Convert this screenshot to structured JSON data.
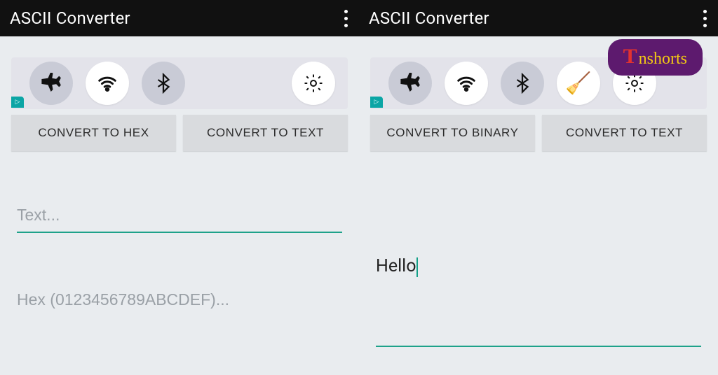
{
  "left": {
    "title": "ASCII Converter",
    "buttons": {
      "hex": "CONVERT TO HEX",
      "text": "CONVERT TO TEXT"
    },
    "placeholders": {
      "text": "Text...",
      "hex": "Hex (0123456789ABCDEF)..."
    },
    "icons": [
      "airplane",
      "wifi",
      "bluetooth",
      "gear"
    ],
    "ad_badge": "▷"
  },
  "right": {
    "title": "ASCII Converter",
    "buttons": {
      "binary": "CONVERT TO BINARY",
      "text": "CONVERT TO TEXT"
    },
    "input_value": "Hello",
    "icons": [
      "airplane",
      "wifi",
      "bluetooth",
      "broom",
      "gear"
    ],
    "ad_badge": "▷"
  },
  "logo": {
    "first": "T",
    "rest": "nshorts"
  }
}
